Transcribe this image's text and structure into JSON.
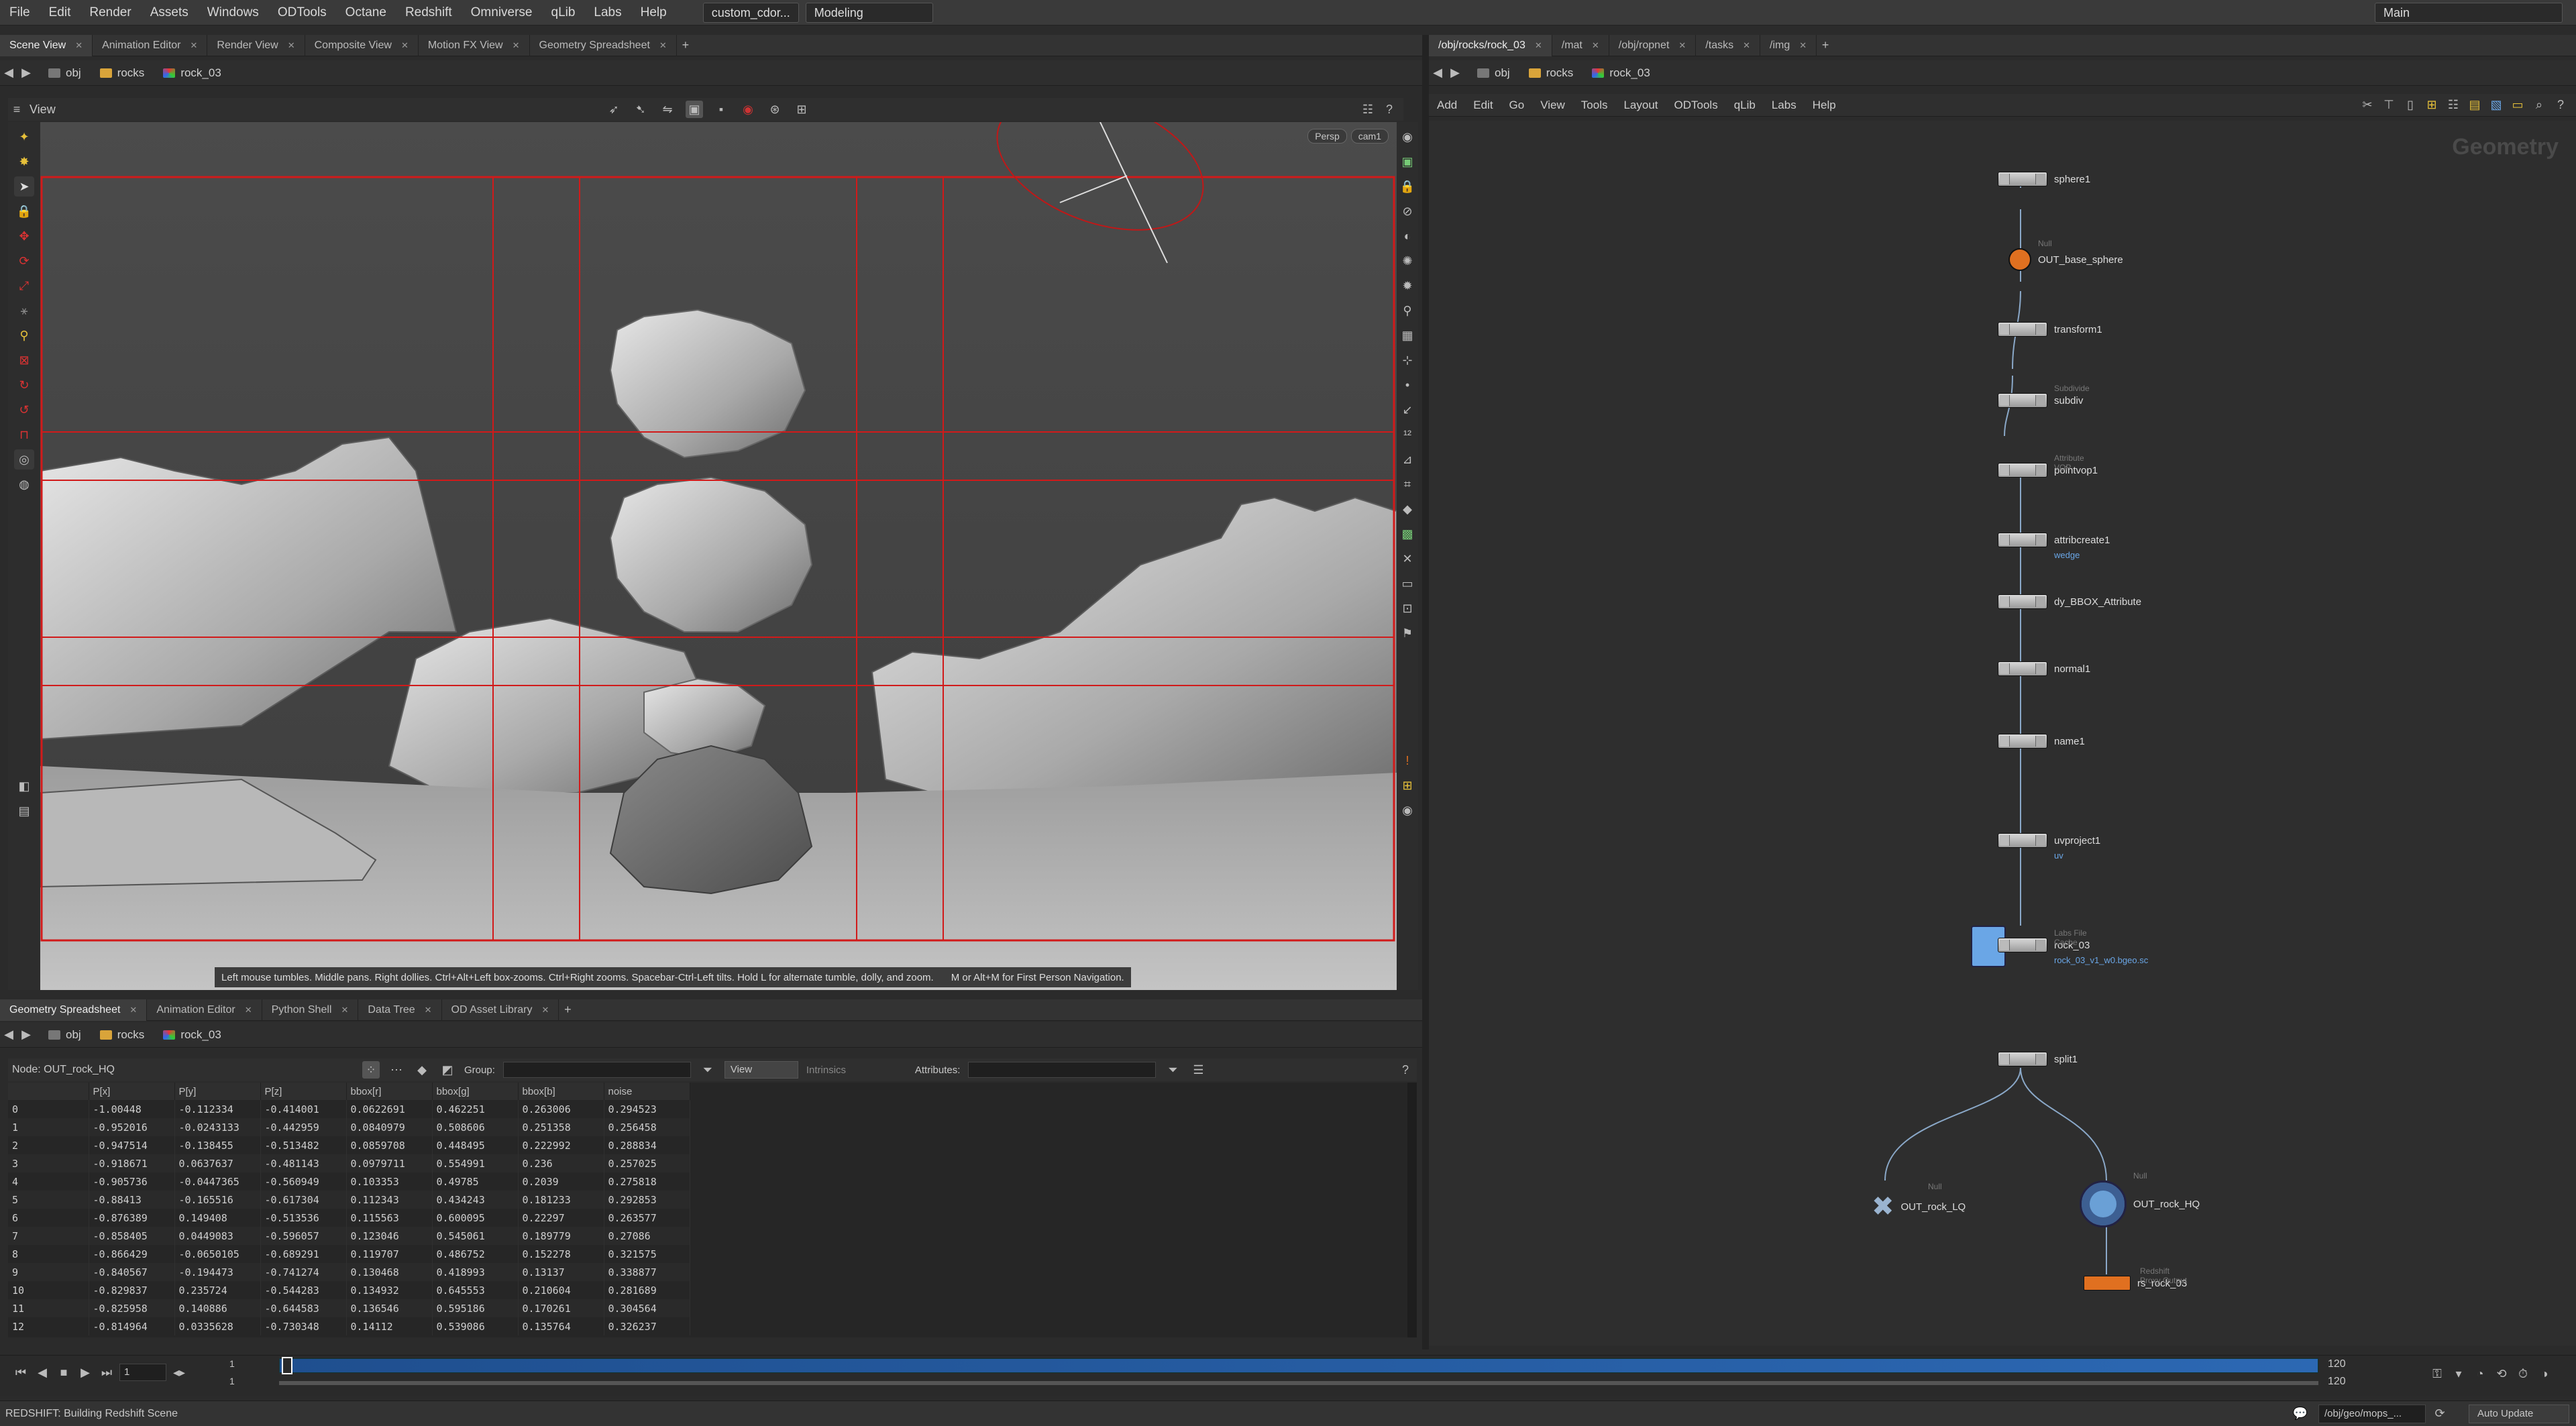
{
  "menubar": {
    "items": [
      "File",
      "Edit",
      "Render",
      "Assets",
      "Windows",
      "ODTools",
      "Octane",
      "Redshift",
      "Omniverse",
      "qLib",
      "Labs",
      "Help"
    ],
    "desktop_file": "custom_cdor...",
    "desktop_mode": "Modeling",
    "desktop_main": "Main"
  },
  "left_tabs": [
    "Scene View",
    "Animation Editor",
    "Render View",
    "Composite View",
    "Motion FX View",
    "Geometry Spreadsheet"
  ],
  "right_tabs": [
    "/obj/rocks/rock_03",
    "/mat",
    "/obj/ropnet",
    "/tasks",
    "/img"
  ],
  "path": {
    "obj": "obj",
    "rocks": "rocks",
    "rock": "rock_03"
  },
  "viewport": {
    "title": "View",
    "persp_label": "Persp",
    "cam_label": "cam1",
    "help_text": "Left mouse tumbles. Middle pans. Right dollies. Ctrl+Alt+Left box-zooms. Ctrl+Right zooms. Spacebar-Ctrl-Left tilts. Hold L for alternate tumble, dolly, and zoom.",
    "help_text2": "M or Alt+M for First Person Navigation."
  },
  "bottom_tabs": [
    "Geometry Spreadsheet",
    "Animation Editor",
    "Python Shell",
    "Data Tree",
    "OD Asset Library"
  ],
  "spreadsheet": {
    "node_label": "Node: OUT_rock_HQ",
    "group_label": "Group:",
    "view_label": "View",
    "intrinsics_label": "Intrinsics",
    "attributes_label": "Attributes:",
    "columns": [
      "",
      "P[x]",
      "P[y]",
      "P[z]",
      "bbox[r]",
      "bbox[g]",
      "bbox[b]",
      "noise"
    ],
    "rows": [
      [
        "0",
        "-1.00448",
        "-0.112334",
        "-0.414001",
        "0.0622691",
        "0.462251",
        "0.263006",
        "0.294523"
      ],
      [
        "1",
        "-0.952016",
        "-0.0243133",
        "-0.442959",
        "0.0840979",
        "0.508606",
        "0.251358",
        "0.256458"
      ],
      [
        "2",
        "-0.947514",
        "-0.138455",
        "-0.513482",
        "0.0859708",
        "0.448495",
        "0.222992",
        "0.288834"
      ],
      [
        "3",
        "-0.918671",
        "0.0637637",
        "-0.481143",
        "0.0979711",
        "0.554991",
        "0.236",
        "0.257025"
      ],
      [
        "4",
        "-0.905736",
        "-0.0447365",
        "-0.560949",
        "0.103353",
        "0.49785",
        "0.2039",
        "0.275818"
      ],
      [
        "5",
        "-0.88413",
        "-0.165516",
        "-0.617304",
        "0.112343",
        "0.434243",
        "0.181233",
        "0.292853"
      ],
      [
        "6",
        "-0.876389",
        "0.149408",
        "-0.513536",
        "0.115563",
        "0.600095",
        "0.22297",
        "0.263577"
      ],
      [
        "7",
        "-0.858405",
        "0.0449083",
        "-0.596057",
        "0.123046",
        "0.545061",
        "0.189779",
        "0.27086"
      ],
      [
        "8",
        "-0.866429",
        "-0.0650105",
        "-0.689291",
        "0.119707",
        "0.486752",
        "0.152278",
        "0.321575"
      ],
      [
        "9",
        "-0.840567",
        "-0.194473",
        "-0.741274",
        "0.130468",
        "0.418993",
        "0.13137",
        "0.338877"
      ],
      [
        "10",
        "-0.829837",
        "0.235724",
        "-0.544283",
        "0.134932",
        "0.645553",
        "0.210604",
        "0.281689"
      ],
      [
        "11",
        "-0.825958",
        "0.140886",
        "-0.644583",
        "0.136546",
        "0.595186",
        "0.170261",
        "0.304564"
      ],
      [
        "12",
        "-0.814964",
        "0.0335628",
        "-0.730348",
        "0.14112",
        "0.539086",
        "0.135764",
        "0.326237"
      ]
    ]
  },
  "network": {
    "menu": [
      "Add",
      "Edit",
      "Go",
      "View",
      "Tools",
      "Layout",
      "ODTools",
      "qLib",
      "Labs",
      "Help"
    ],
    "context_label": "Geometry",
    "nodes": [
      {
        "name": "sphere1",
        "sub": "",
        "info": ""
      },
      {
        "name": "OUT_base_sphere",
        "sub": "Null",
        "info": ""
      },
      {
        "name": "transform1",
        "sub": "",
        "info": ""
      },
      {
        "name": "subdiv",
        "sub": "Subdivide",
        "info": ""
      },
      {
        "name": "pointvop1",
        "sub": "Attribute VOP",
        "info": ""
      },
      {
        "name": "attribcreate1",
        "sub": "",
        "info": "wedge"
      },
      {
        "name": "dy_BBOX_Attribute",
        "sub": "",
        "info": ""
      },
      {
        "name": "normal1",
        "sub": "",
        "info": ""
      },
      {
        "name": "name1",
        "sub": "",
        "info": ""
      },
      {
        "name": "uvproject1",
        "sub": "",
        "info": "uv"
      },
      {
        "name": "rock_03",
        "sub": "Labs File Cache",
        "info": "rock_03_v1_w0.bgeo.sc"
      },
      {
        "name": "split1",
        "sub": "",
        "info": ""
      },
      {
        "name": "OUT_rock_LQ",
        "sub": "Null",
        "info": ""
      },
      {
        "name": "OUT_rock_HQ",
        "sub": "Null",
        "info": ""
      },
      {
        "name": "rs_rock_03",
        "sub": "Redshift Proxy Output",
        "info": ""
      }
    ]
  },
  "timeline": {
    "frame": "1",
    "start": "1",
    "start2": "1",
    "end": "120",
    "end2": "120"
  },
  "status": {
    "text": "REDSHIFT: Building Redshift Scene",
    "path": "/obj/geo/mops_...",
    "update_mode": "Auto Update"
  },
  "colors": {
    "accent": "#e07020",
    "guide": "#d11a1a",
    "link": "#6aa6e6"
  }
}
